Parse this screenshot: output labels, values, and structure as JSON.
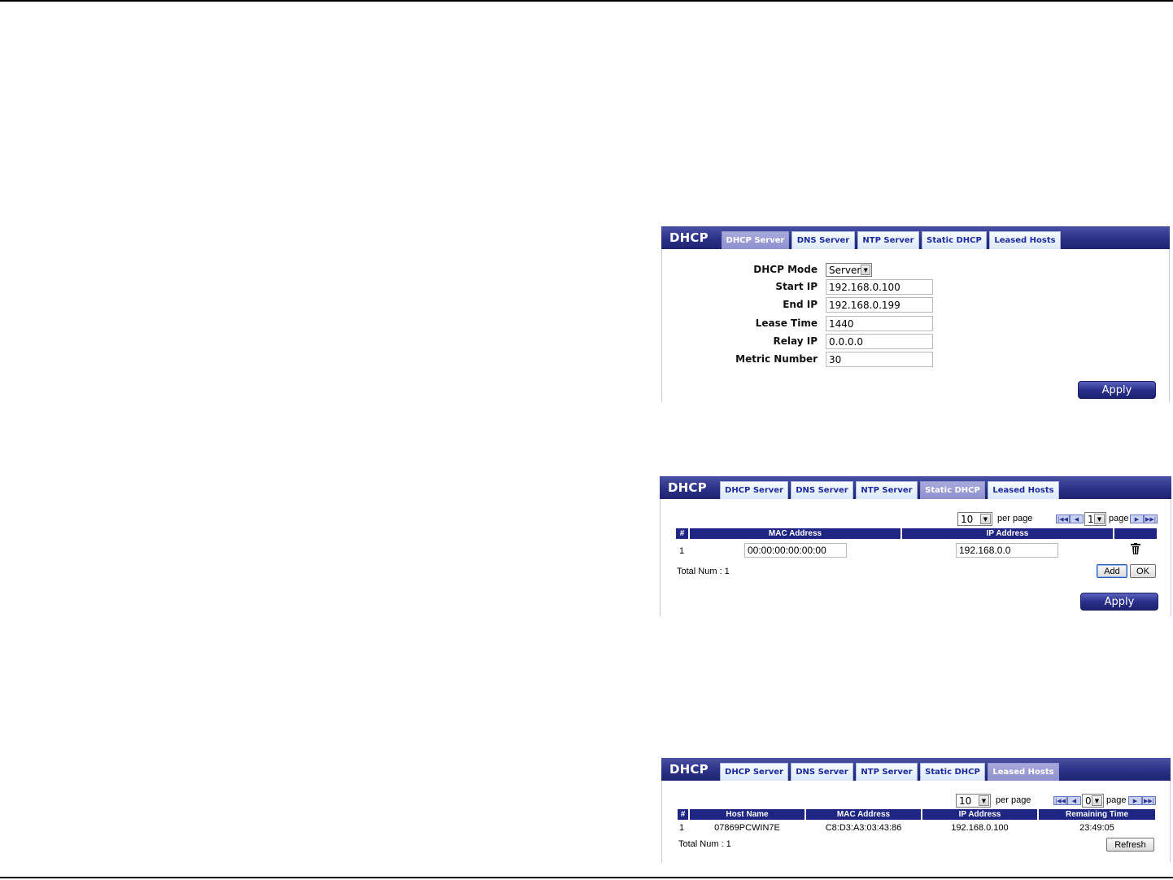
{
  "panel1": {
    "title": "DHCP",
    "tabs": [
      "DHCP Server",
      "DNS Server",
      "NTP Server",
      "Static DHCP",
      "Leased Hosts"
    ],
    "active_tab": "DHCP Server",
    "fields": {
      "dhcp_mode_label": "DHCP Mode",
      "dhcp_mode_value": "Server",
      "start_ip_label": "Start IP",
      "start_ip_value": "192.168.0.100",
      "end_ip_label": "End IP",
      "end_ip_value": "192.168.0.199",
      "lease_time_label": "Lease Time",
      "lease_time_value": "1440",
      "relay_ip_label": "Relay IP",
      "relay_ip_value": "0.0.0.0",
      "metric_label": "Metric Number",
      "metric_value": "30"
    },
    "apply_label": "Apply"
  },
  "panel2": {
    "title": "DHCP",
    "tabs": [
      "DHCP Server",
      "DNS Server",
      "NTP Server",
      "Static DHCP",
      "Leased Hosts"
    ],
    "active_tab": "Static DHCP",
    "per_page_value": "10",
    "per_page_label": "per page",
    "page_value": "1",
    "page_label": "page",
    "columns": [
      "#",
      "MAC Address",
      "IP Address"
    ],
    "rows": [
      {
        "num": "1",
        "mac": "00:00:00:00:00:00",
        "ip": "192.168.0.0"
      }
    ],
    "total": "Total Num : 1",
    "add_label": "Add",
    "ok_label": "OK",
    "apply_label": "Apply"
  },
  "panel3": {
    "title": "DHCP",
    "tabs": [
      "DHCP Server",
      "DNS Server",
      "NTP Server",
      "Static DHCP",
      "Leased Hosts"
    ],
    "active_tab": "Leased Hosts",
    "per_page_value": "10",
    "per_page_label": "per page",
    "page_value": "0",
    "page_label": "page",
    "columns": [
      "#",
      "Host Name",
      "MAC Address",
      "IP Address",
      "Remaining Time"
    ],
    "rows": [
      {
        "num": "1",
        "host": "07869PCWIN7E",
        "mac": "C8:D3:A3:03:43:86",
        "ip": "192.168.0.100",
        "remaining": "23:49:05"
      }
    ],
    "total": "Total Num : 1",
    "refresh_label": "Refresh"
  },
  "colors": {
    "header_dark": "#1e2370",
    "active_tab": "#8e90ce",
    "tab_text": "#1c2a9c"
  }
}
